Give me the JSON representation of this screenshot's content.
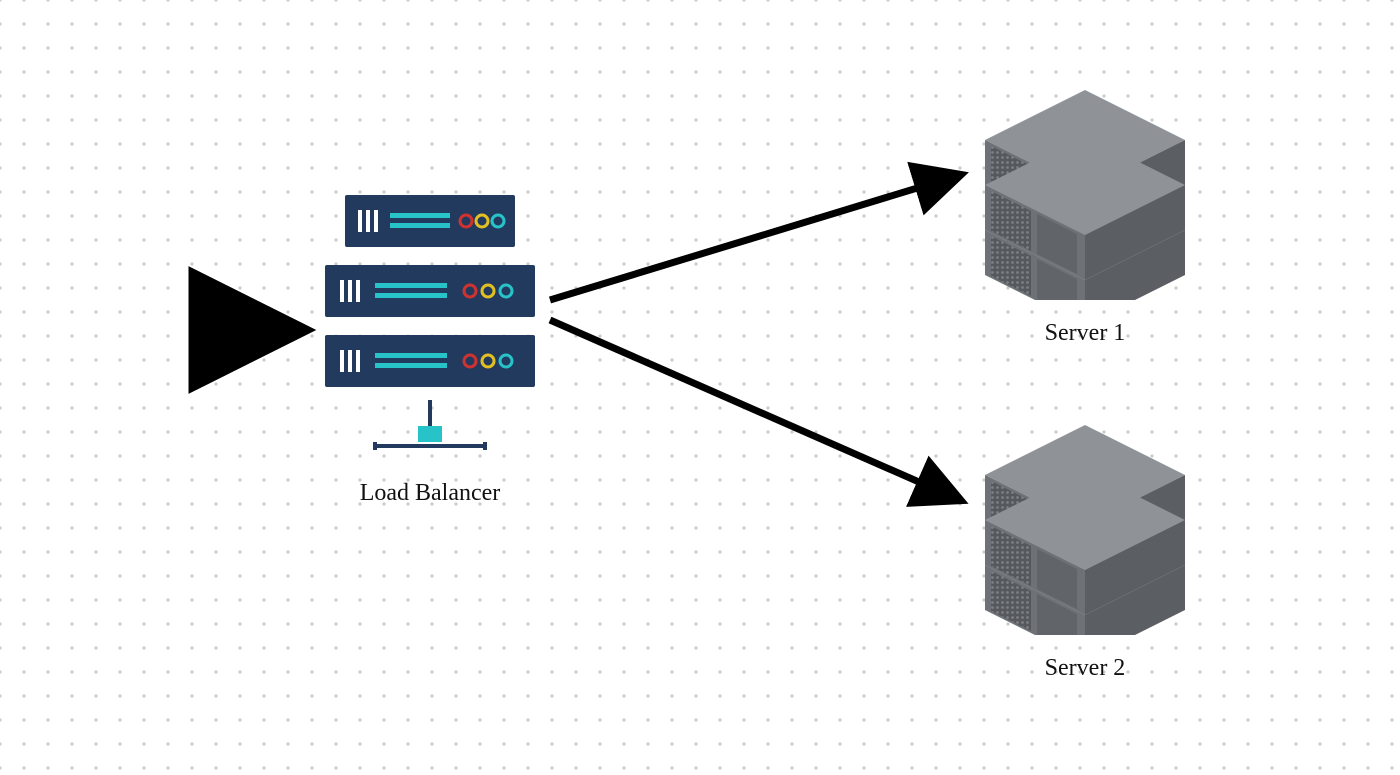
{
  "diagram": {
    "nodes": {
      "load_balancer": {
        "label": "Load Balancer"
      },
      "server1": {
        "label": "Server 1"
      },
      "server2": {
        "label": "Server 2"
      }
    },
    "edges": [
      {
        "from": "input",
        "to": "load_balancer"
      },
      {
        "from": "load_balancer",
        "to": "server1"
      },
      {
        "from": "load_balancer",
        "to": "server2"
      }
    ],
    "colors": {
      "rack_body": "#223a5e",
      "rack_accent": "#27c3c9",
      "led_red": "#d0332f",
      "led_yellow": "#e3c022",
      "led_teal": "#27c3c9",
      "server_top": "#8f9297",
      "server_side": "#5b5e63",
      "server_front": "#6e7176",
      "arrow": "#000000"
    }
  }
}
